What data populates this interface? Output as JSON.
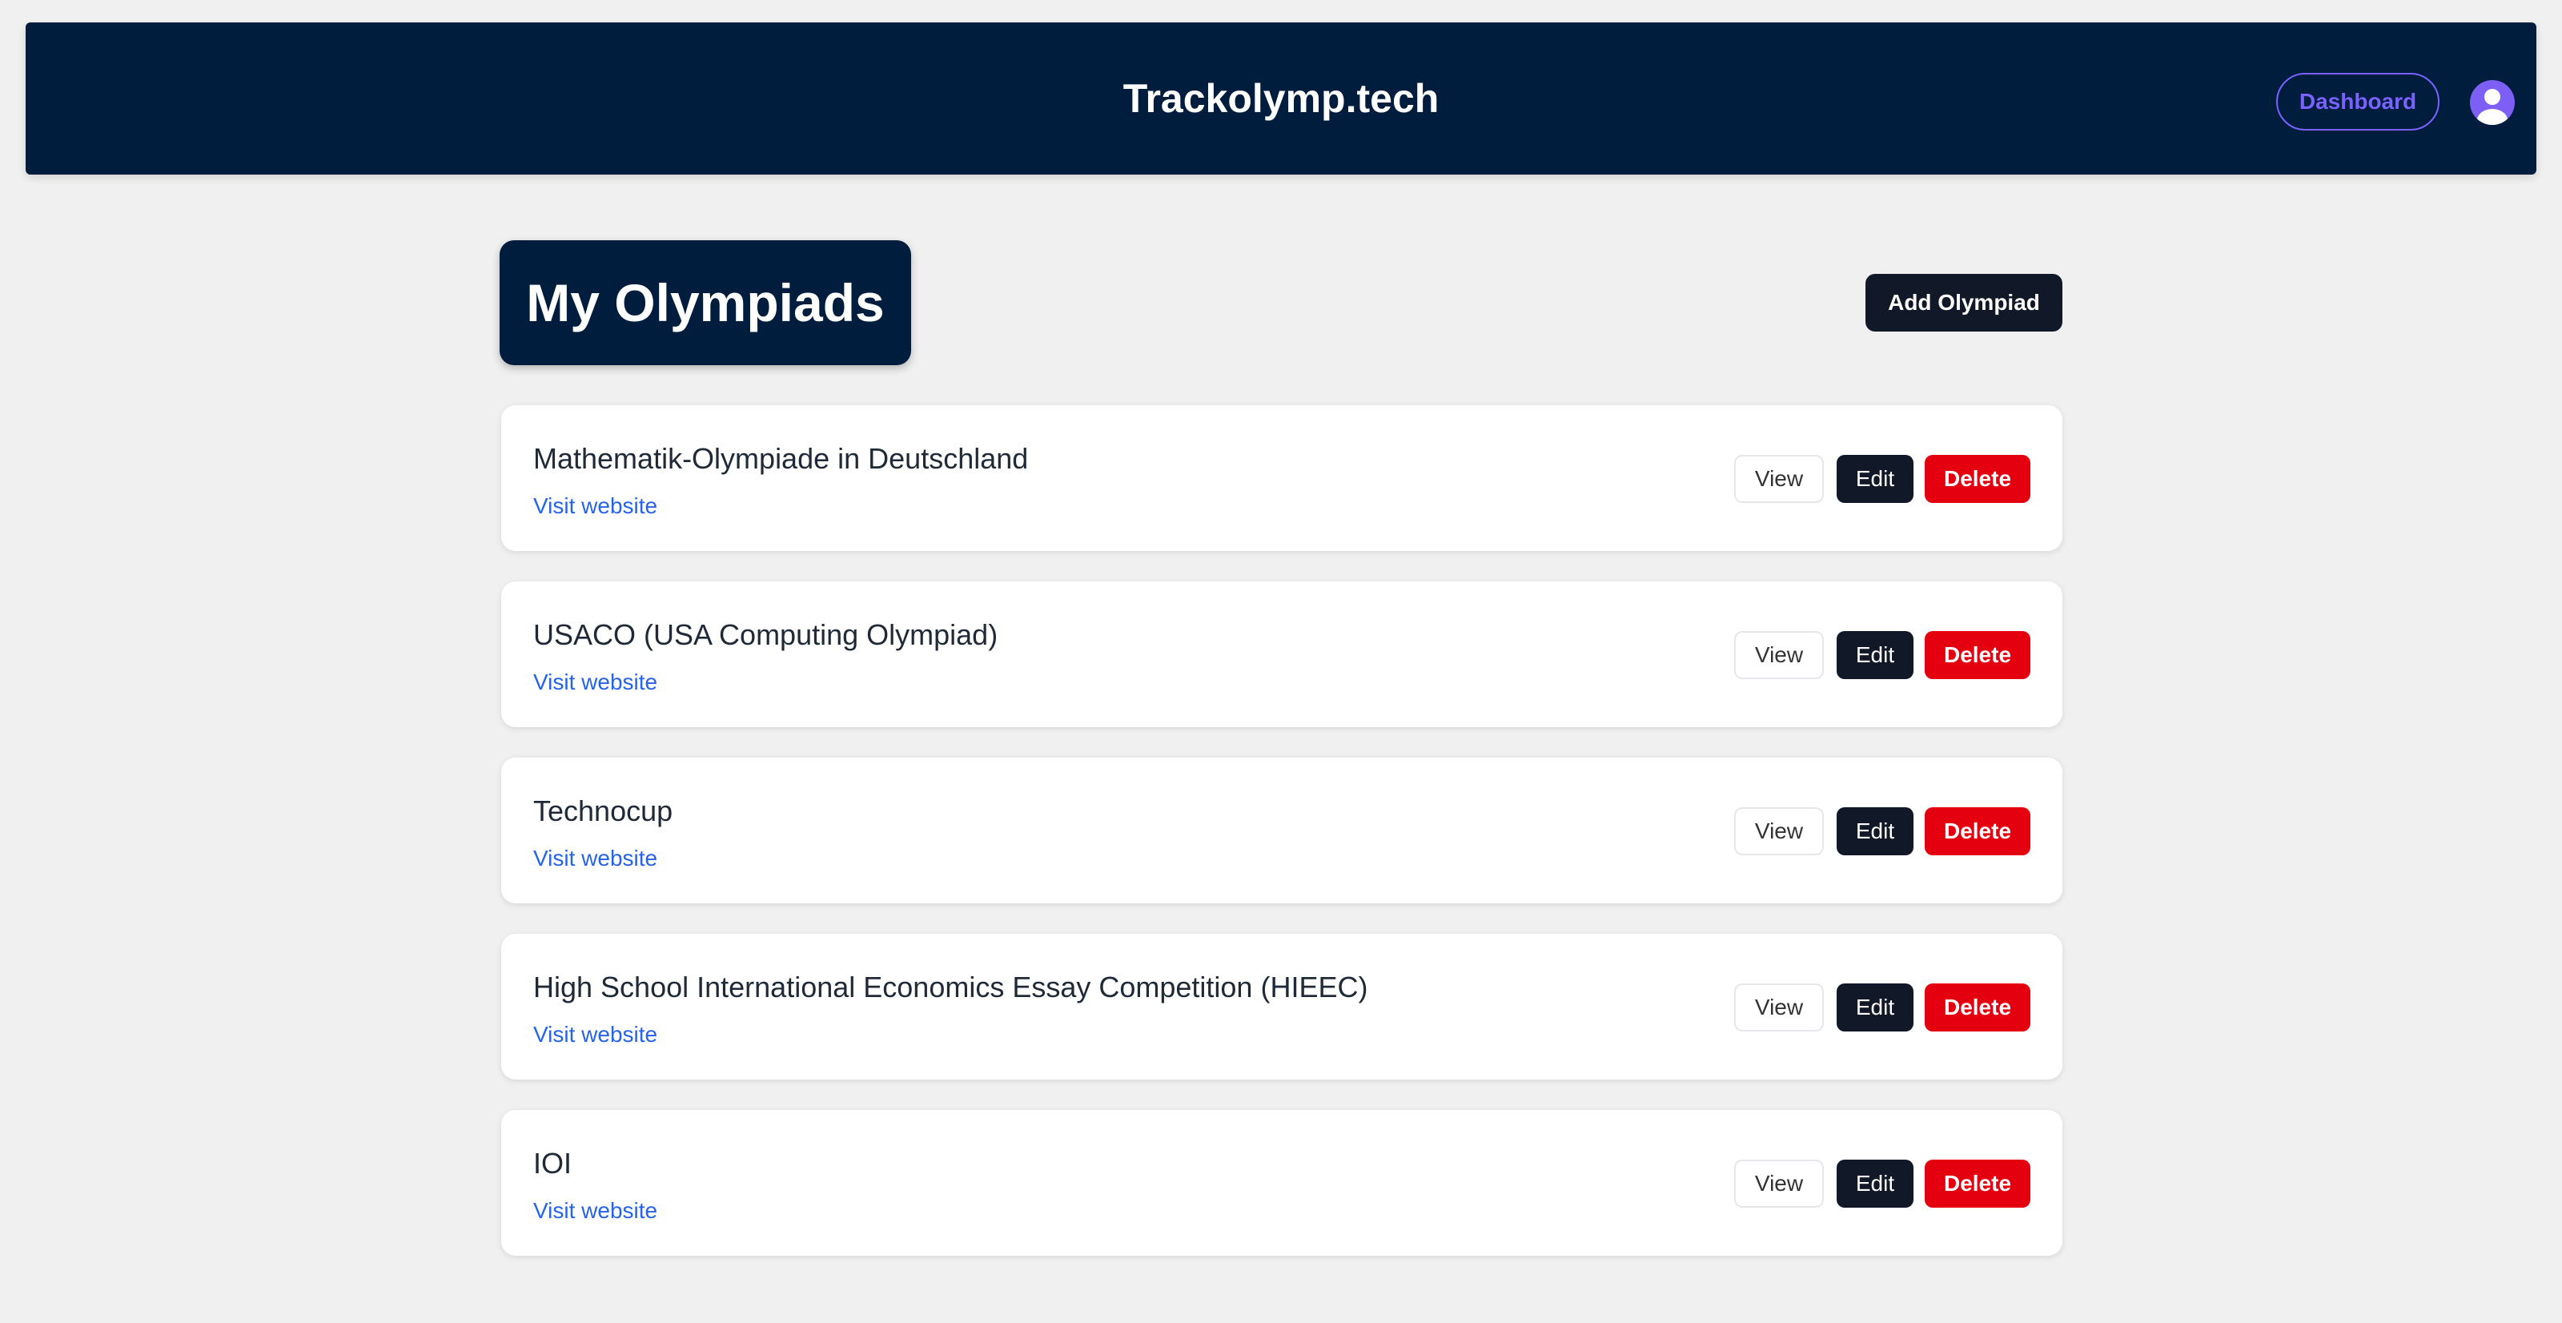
{
  "header": {
    "brand": "Trackolymp.tech",
    "dashboard_label": "Dashboard",
    "avatar_icon": "user-avatar-icon"
  },
  "main": {
    "title": "My Olympiads",
    "add_label": "Add Olympiad"
  },
  "olympiads": [
    {
      "name": "Mathematik-Olympiade in Deutschland",
      "link": "Visit website",
      "view": "View",
      "edit": "Edit",
      "delete": "Delete"
    },
    {
      "name": "USACO (USA Computing Olympiad)",
      "link": "Visit website",
      "view": "View",
      "edit": "Edit",
      "delete": "Delete"
    },
    {
      "name": "Technocup",
      "link": "Visit website",
      "view": "View",
      "edit": "Edit",
      "delete": "Delete"
    },
    {
      "name": "High School International Economics Essay Competition (HIEEC)",
      "link": "Visit website",
      "view": "View",
      "edit": "Edit",
      "delete": "Delete"
    },
    {
      "name": "IOI",
      "link": "Visit website",
      "view": "View",
      "edit": "Edit",
      "delete": "Delete"
    }
  ],
  "colors": {
    "navbar": "#001d3d",
    "accent": "#7b61ff",
    "delete": "#e5000f",
    "link": "#2563eb"
  }
}
